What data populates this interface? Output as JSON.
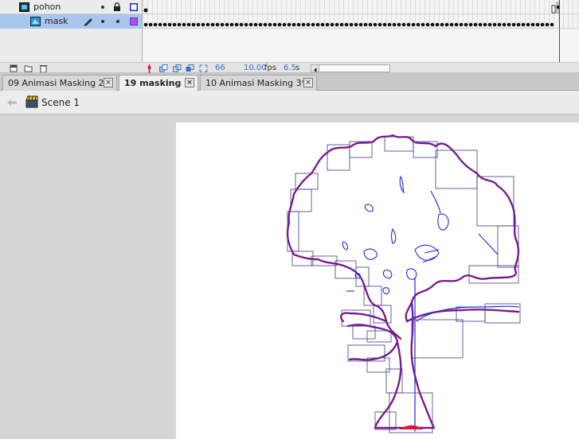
{
  "timeline": {
    "layers": [
      {
        "name": "pohon",
        "selected": false
      },
      {
        "name": "mask",
        "selected": true
      }
    ],
    "footer": {
      "current_frame": "66",
      "frame_rate": "10.00",
      "frame_rate_unit": "fps",
      "elapsed_time": "6.5",
      "elapsed_unit": "s"
    }
  },
  "tabs": [
    {
      "label": "09 Animasi Masking 2",
      "active": false
    },
    {
      "label": "19 masking 2",
      "active": true
    },
    {
      "label": "10 Animasi Masking 3*",
      "active": false
    }
  ],
  "tab_close_glyph": "×",
  "editbar": {
    "scene_label": "Scene 1"
  },
  "colors": {
    "selected_layer": "#a9c6ee",
    "playhead": "#e01010",
    "outline_blue": "#1f2bd6",
    "outline_red": "#e0143c",
    "mask_outline_color": "#6a2bd6"
  },
  "icons": {
    "layer_folder": "layer-icon",
    "mask_layer": "mask-layer-icon",
    "lock": "lock-icon",
    "pencil": "pencil-icon",
    "new_layer": "new-layer-icon",
    "new_folder": "new-folder-icon",
    "trash": "trash-icon",
    "back": "back-arrow-icon",
    "scene": "scene-clapper-icon"
  }
}
